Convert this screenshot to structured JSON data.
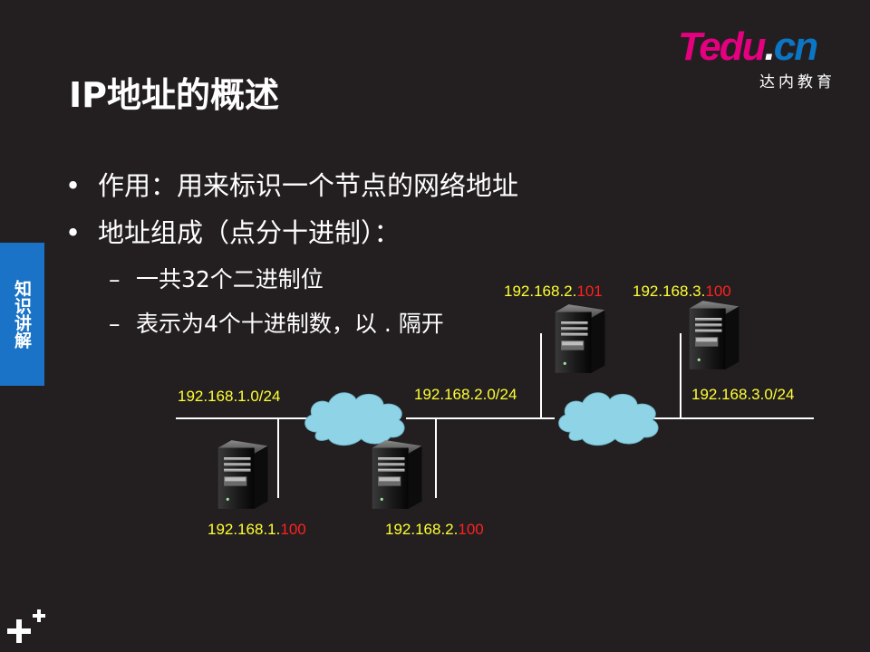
{
  "logo": {
    "t": "T",
    "edu": "edu",
    "dot": ".",
    "cn": "cn",
    "subtitle": "达内教育",
    "brand_color": "#e4007f",
    "accent_color": "#0b76c5"
  },
  "title": "IP地址的概述",
  "side_tab": {
    "label": "知识讲解",
    "color": "#1a73c6"
  },
  "bullets": [
    {
      "mark": "•",
      "text": "作用：用来标识一个节点的网络地址"
    },
    {
      "mark": "•",
      "text": "地址组成（点分十进制）："
    }
  ],
  "sub_bullets": [
    {
      "mark": "–",
      "text": "一共32个二进制位"
    },
    {
      "mark": "–",
      "text": "表示为4个十进制数，以 . 隔开"
    }
  ],
  "networks": [
    {
      "label": "192.168.1.0/24"
    },
    {
      "label": "192.168.2.0/24"
    },
    {
      "label": "192.168.3.0/24"
    }
  ],
  "hosts": [
    {
      "net": "192.168.1.",
      "host": "100",
      "icon": "server-icon"
    },
    {
      "net": "192.168.2.",
      "host": "100",
      "icon": "server-icon"
    },
    {
      "net": "192.168.2.",
      "host": "101",
      "icon": "server-icon"
    },
    {
      "net": "192.168.3.",
      "host": "100",
      "icon": "server-icon"
    }
  ],
  "colors": {
    "background": "#231f20",
    "network_label": "#ffff33",
    "host_part": "#ff2020",
    "cloud": "#8fd4e6"
  }
}
